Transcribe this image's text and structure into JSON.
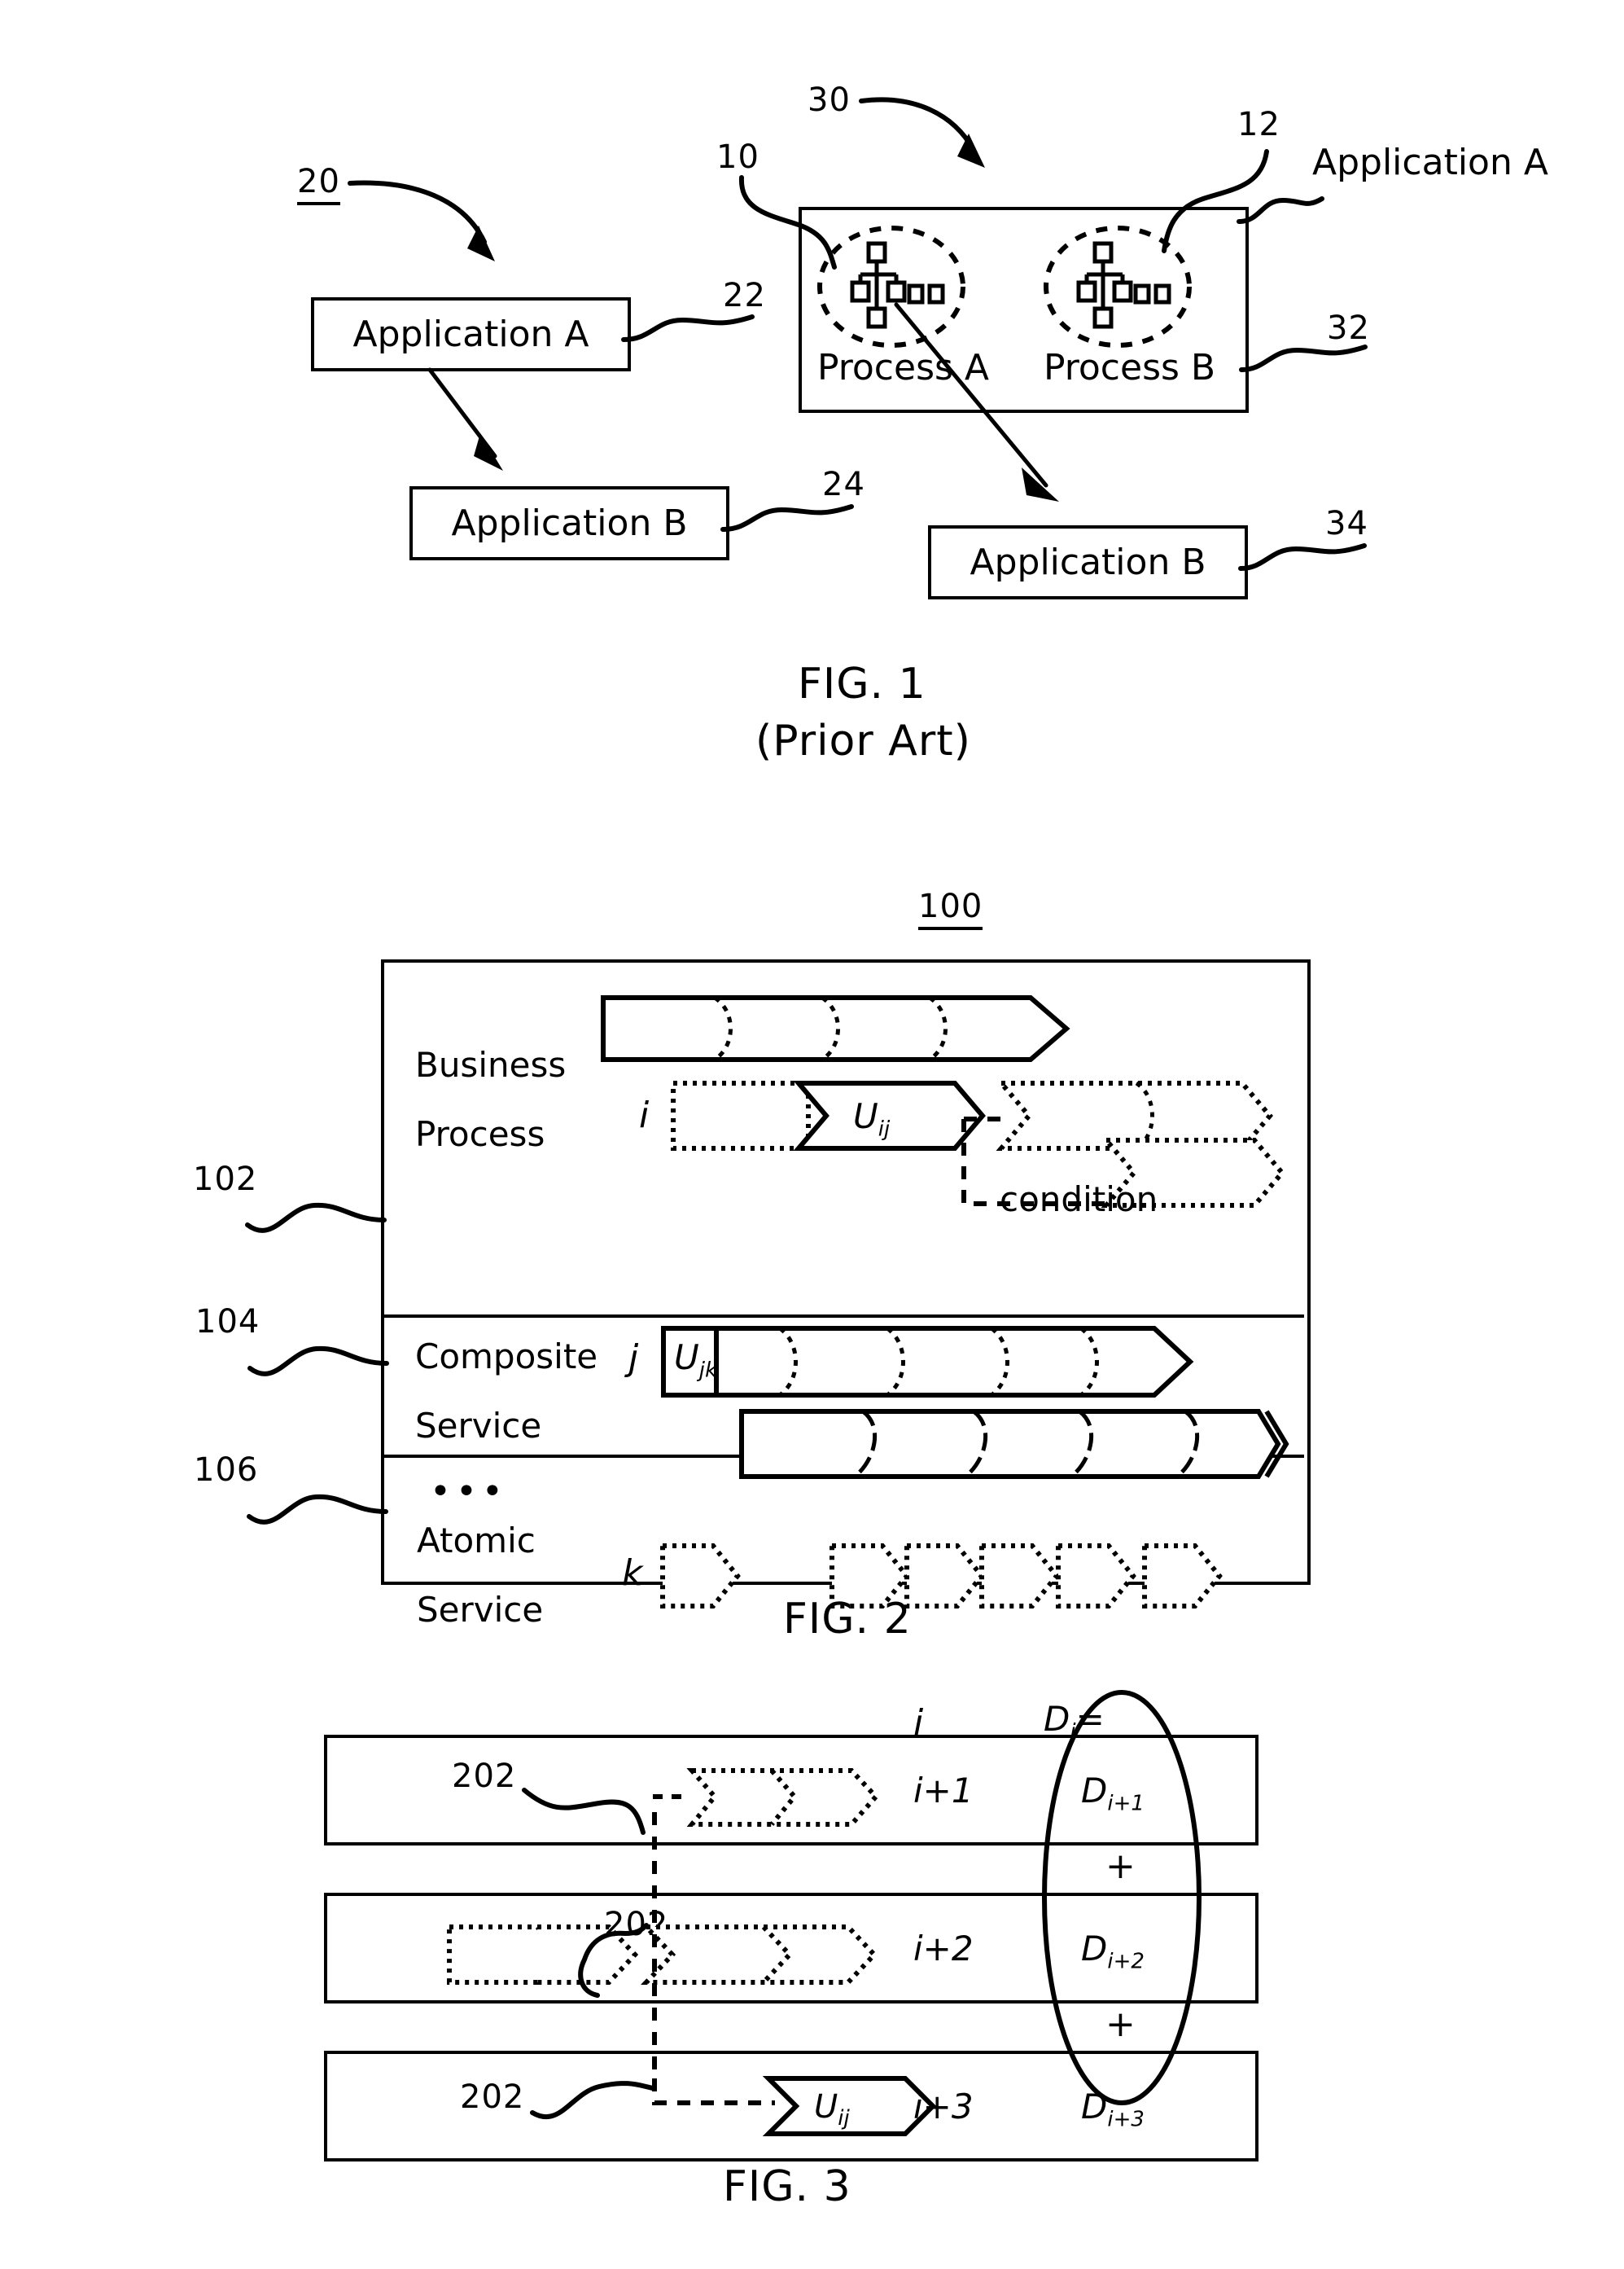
{
  "document": {
    "type": "patent-drawing-sheet",
    "figures": [
      {
        "id": "fig1",
        "caption": "FIG. 1",
        "subcaption": "(Prior Art)",
        "reference_numbers": [
          "20",
          "10",
          "30",
          "12",
          "22",
          "32",
          "24",
          "34"
        ],
        "left_diagram": {
          "ref": "20",
          "boxes": [
            {
              "ref": "22",
              "label": "Application A"
            },
            {
              "ref": "24",
              "label": "Application B"
            }
          ]
        },
        "right_diagram": {
          "ref": "30",
          "container_ref": "32",
          "container_label": "Application A",
          "processes": [
            {
              "ref": "10",
              "label": "Process A",
              "icon": "process-network-icon"
            },
            {
              "ref": "12",
              "label": "Process B",
              "icon": "process-network-icon"
            }
          ],
          "target_box": {
            "ref": "34",
            "label": "Application B"
          }
        }
      },
      {
        "id": "fig2",
        "caption": "FIG. 2",
        "diagram_ref": "100",
        "tiers": [
          {
            "ref": "102",
            "label_line1": "Business",
            "label_line2": "Process",
            "index_symbol": "i",
            "unit_symbol": "U",
            "unit_sub": "ij",
            "condition_label": "condition"
          },
          {
            "ref": "104",
            "label_line1": "Composite",
            "label_line2": "Service",
            "index_symbol": "j",
            "unit_symbol": "U",
            "unit_sub": "jk"
          },
          {
            "ref": "106",
            "label_line1": "Atomic",
            "label_line2": "Service",
            "index_symbol": "k",
            "ellipsis": "•••"
          }
        ]
      },
      {
        "id": "fig3",
        "caption": "FIG. 3",
        "top_index": "i",
        "sum_head": "D",
        "sum_head_sub": "i",
        "sum_head_eq": "=",
        "plus_symbol": "+",
        "rows": [
          {
            "callout": "202",
            "index": "i+1",
            "d_symbol": "D",
            "d_sub": "i+1",
            "kind": "dotted-chevrons"
          },
          {
            "callout": "202",
            "index": "i+2",
            "d_symbol": "D",
            "d_sub": "i+2",
            "kind": "dotted-pair"
          },
          {
            "callout": "202",
            "index": "i+3",
            "d_symbol": "D",
            "d_sub": "i+3",
            "kind": "solid-unit",
            "unit_symbol": "U",
            "unit_sub": "ij"
          }
        ]
      }
    ]
  },
  "colors": {
    "ink": "#000000",
    "paper": "#ffffff"
  }
}
